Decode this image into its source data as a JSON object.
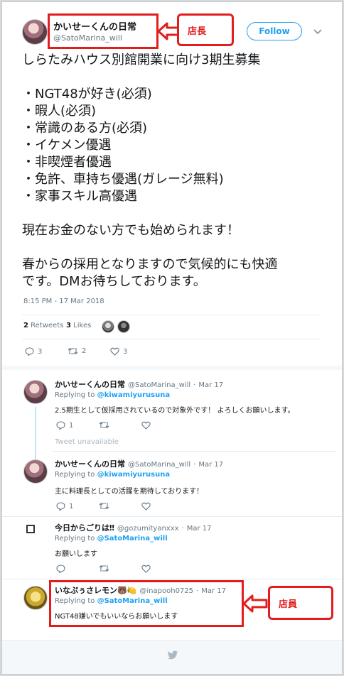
{
  "main_tweet": {
    "author_name": "かいせーくんの日常",
    "author_handle": "@SatoMarina_will",
    "follow_label": "Follow",
    "lines": [
      "しらたみハウス別館開業に向け3期生募集",
      "",
      "・NGT48が好き(必須)",
      "・暇人(必須)",
      "・常識のある方(必須)",
      "・イケメン優遇",
      "・非喫煙者優遇",
      "・免許、車持ち優遇(ガレージ無料)",
      "・家事スキル高優遇",
      "",
      "現在お金のない方でも始められます！",
      "",
      "春からの採用となりますので気候的にも快適",
      "です。DMお待ちしております。"
    ],
    "timestamp": "8:15 PM - 17 Mar 2018",
    "retweets_count": "2",
    "retweets_label": "Retweets",
    "likes_count": "3",
    "likes_label": "Likes",
    "actions": {
      "replies": "3",
      "retweets": "2",
      "likes": "3"
    }
  },
  "annotations": {
    "top_label": "店長",
    "bottom_label": "店員"
  },
  "replies": [
    {
      "name": "かいせーくんの日常",
      "handle": "@SatoMarina_will",
      "date": "Mar 17",
      "replying_prefix": "Replying to",
      "replying_to": "@kiwamiyurusuna",
      "text": "2.5期生として仮採用されているので対象外です！ よろしくお願いします。",
      "reply_count": "1",
      "retweet_count": "",
      "like_count": ""
    },
    {
      "unavailable": "Tweet unavailable"
    },
    {
      "name": "かいせーくんの日常",
      "handle": "@SatoMarina_will",
      "date": "Mar 17",
      "replying_prefix": "Replying to",
      "replying_to": "@kiwamiyurusuna",
      "text": "主に料理長としての活躍を期待しております！",
      "reply_count": "1",
      "retweet_count": "",
      "like_count": ""
    },
    {
      "name": "今日からごりは‼",
      "handle": "@gozumityanxxx",
      "date": "Mar 17",
      "replying_prefix": "Replying to",
      "replying_to": "@SatoMarina_will",
      "text": "お願いします",
      "reply_count": "",
      "retweet_count": "",
      "like_count": ""
    },
    {
      "name": "いなぷぅさレモン🐻🍋",
      "handle": "@inapooh0725",
      "date": "Mar 17",
      "replying_prefix": "Replying to",
      "replying_to": "@SatoMarina_will",
      "text": "NGT48嫌いでもいいならお願いします"
    }
  ],
  "separator": "·",
  "colors": {
    "accent": "#1da1f2",
    "annotation": "#e31d1d",
    "thread_line": "#bde4f7"
  },
  "footer_icon": "twitter-bird-icon"
}
